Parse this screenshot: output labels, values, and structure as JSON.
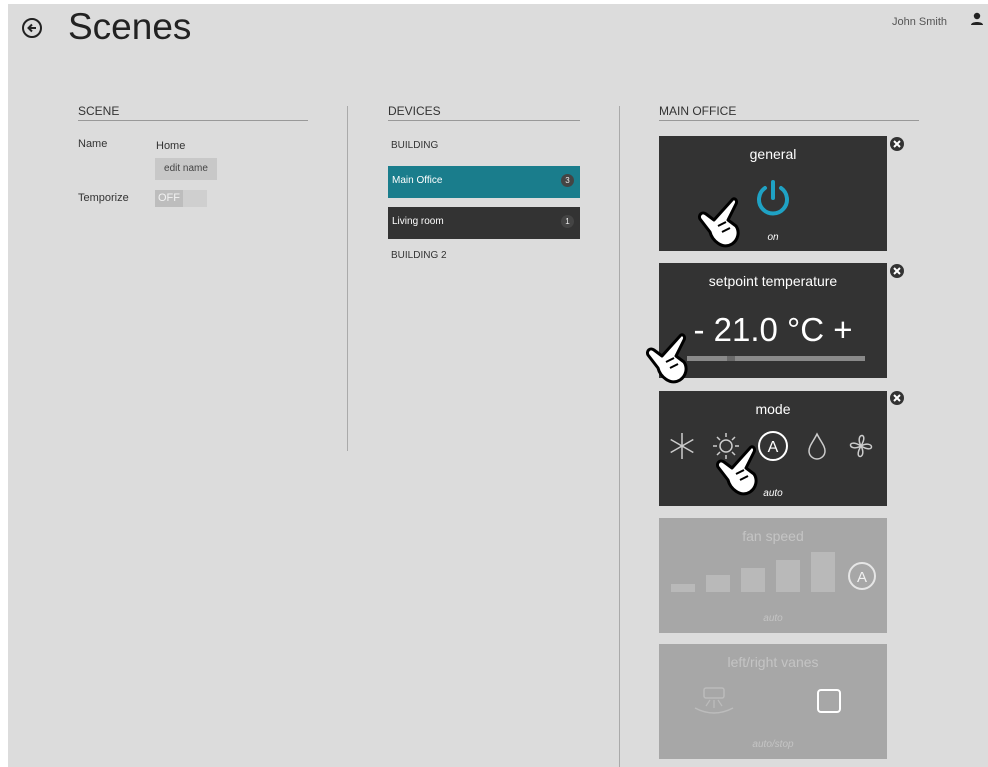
{
  "header": {
    "title": "Scenes",
    "user": "John Smith"
  },
  "scene": {
    "heading": "SCENE",
    "name_label": "Name",
    "name_value": "Home",
    "edit_button": "edit name",
    "temporize_label": "Temporize",
    "temporize_state": "OFF"
  },
  "devices": {
    "heading": "DEVICES",
    "group1": "BUILDING",
    "items": [
      {
        "label": "Main Office",
        "count": "3"
      },
      {
        "label": "Living room",
        "count": "1"
      }
    ],
    "group2": "BUILDING 2"
  },
  "main": {
    "heading": "MAIN OFFICE",
    "general": {
      "title": "general",
      "state": "on"
    },
    "setpoint": {
      "title": "setpoint temperature",
      "minus": "-",
      "value": "21.0 °C",
      "plus": "+"
    },
    "mode": {
      "title": "mode",
      "state": "auto"
    },
    "fan": {
      "title": "fan speed",
      "state": "auto"
    },
    "vanes": {
      "title": "left/right vanes",
      "state": "auto/stop"
    }
  },
  "colors": {
    "accent": "#1a7d8c",
    "card": "#333333",
    "disabled": "#a7a7a7"
  }
}
